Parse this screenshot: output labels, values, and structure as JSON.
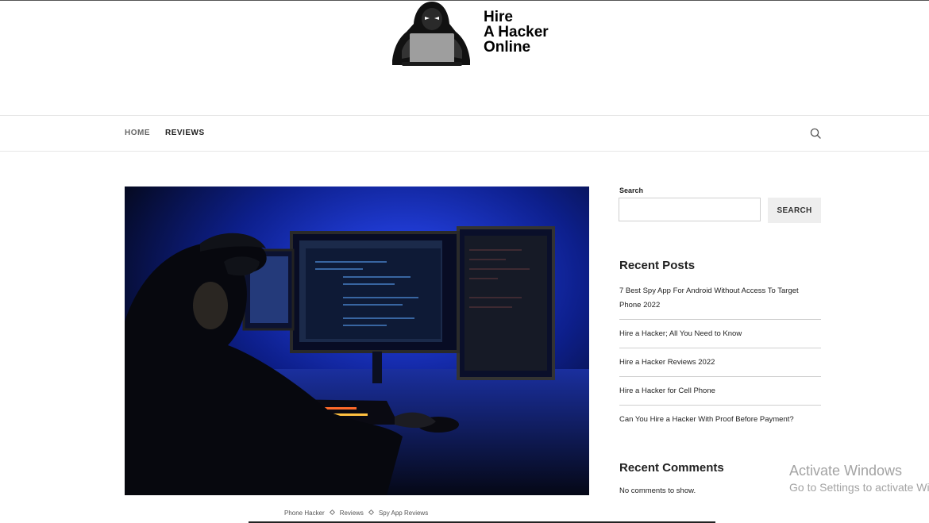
{
  "logo": {
    "lines": [
      "Hire",
      "A Hacker",
      "Online"
    ]
  },
  "nav": {
    "items": [
      "HOME",
      "REVIEWS"
    ],
    "search_icon": "search-icon"
  },
  "sidebar": {
    "search_label": "Search",
    "search_placeholder": "",
    "search_button": "SEARCH",
    "recent_posts_title": "Recent Posts",
    "recent_posts": [
      "7 Best Spy App For Android Without Access To Target Phone 2022",
      "Hire a Hacker; All You Need to Know",
      "Hire a Hacker Reviews 2022",
      "Hire a Hacker for Cell Phone",
      "Can You Hire a Hacker With Proof Before Payment?"
    ],
    "recent_comments_title": "Recent Comments",
    "no_comments": "No comments to show."
  },
  "post": {
    "categories": [
      "Phone Hacker",
      "Reviews",
      "Spy App Reviews"
    ]
  },
  "watermark": {
    "line1": "Activate Windows",
    "line2": "Go to Settings to activate Windows."
  },
  "colors": {
    "text": "#222222",
    "rule": "#cfcfcf",
    "button_bg": "#eeeeee",
    "hero_blue": "#1a3dd8"
  }
}
